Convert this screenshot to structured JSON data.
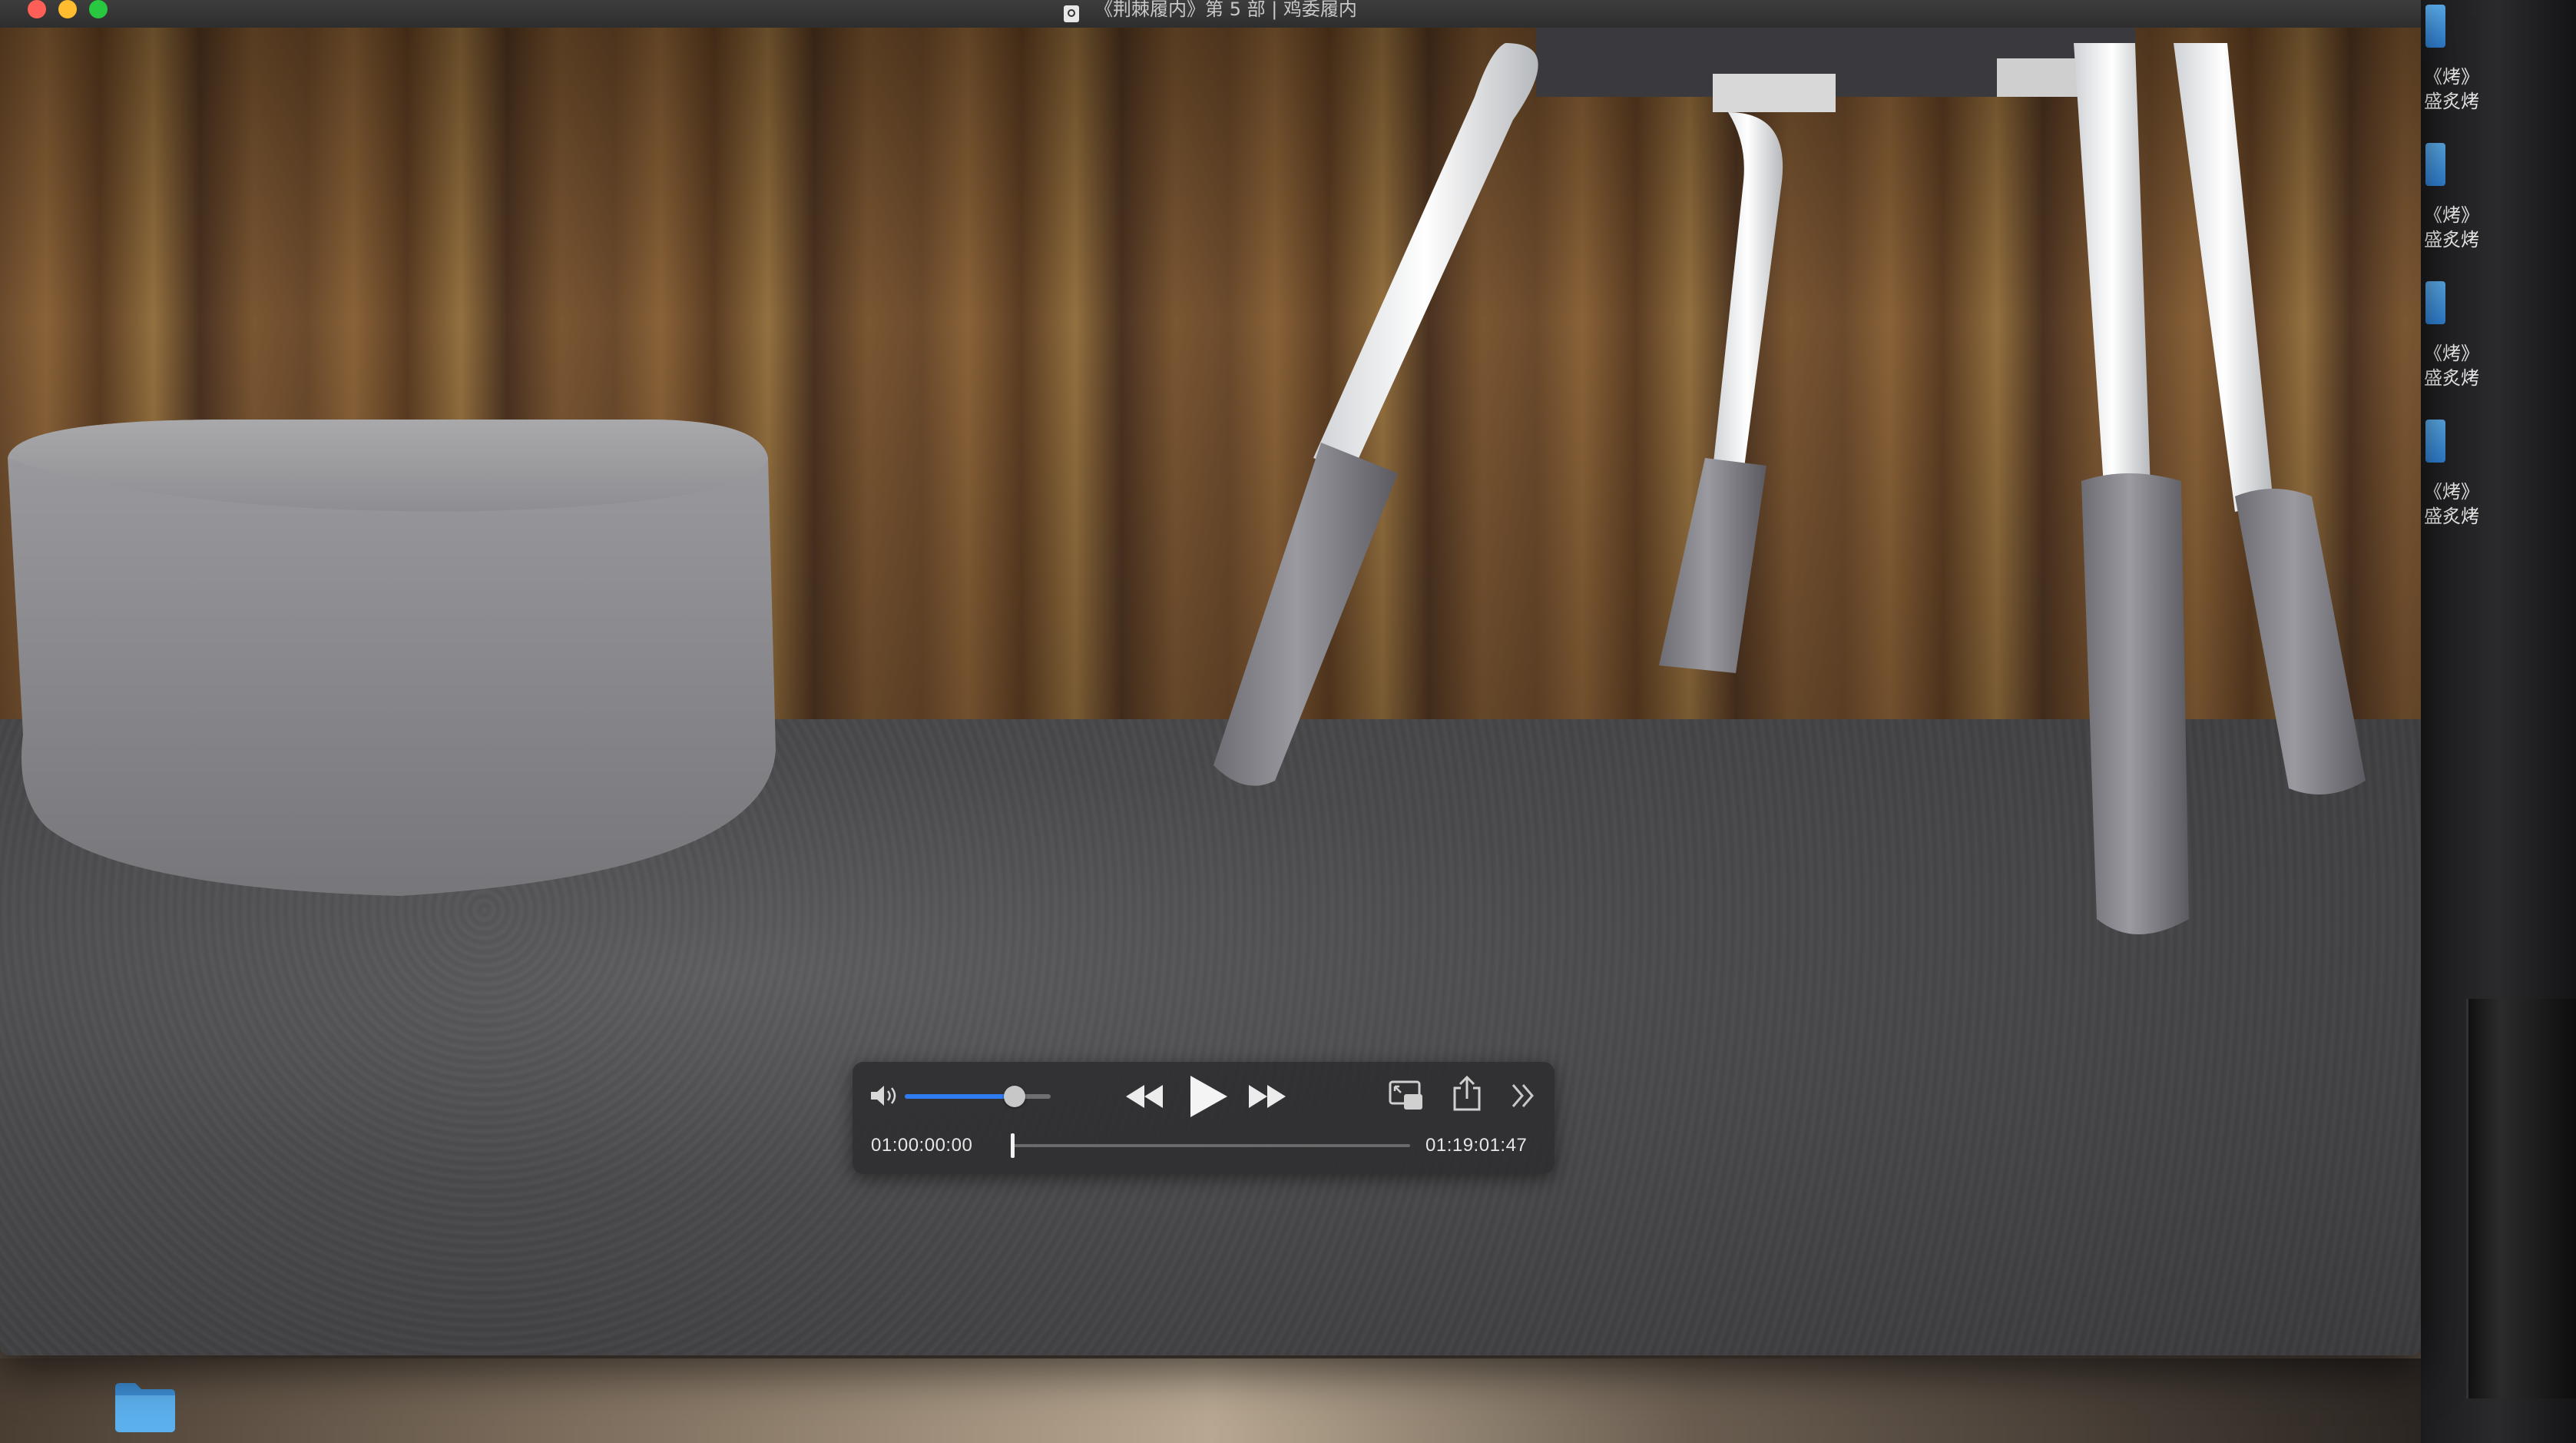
{
  "window": {
    "title": "《荆棘履内》第 5 部 | 鸡委履内"
  },
  "desktop": {
    "files": [
      {
        "label": "《烤》\n盛炙烤"
      },
      {
        "label": "《烤》\n盛炙烤"
      },
      {
        "label": "《烤》\n盛炙烤"
      },
      {
        "label": "《烤》\n盛炙烤"
      }
    ]
  },
  "player": {
    "volume": 0.75,
    "progress": 0.0,
    "current_time": "01:00:00:00",
    "total_time": "01:19:01:47"
  },
  "colors": {
    "accent": "#2f7bf2",
    "close": "#ff5f57",
    "minimize": "#febc2e",
    "maximize": "#28c840",
    "folder": "#4aa3e6"
  }
}
